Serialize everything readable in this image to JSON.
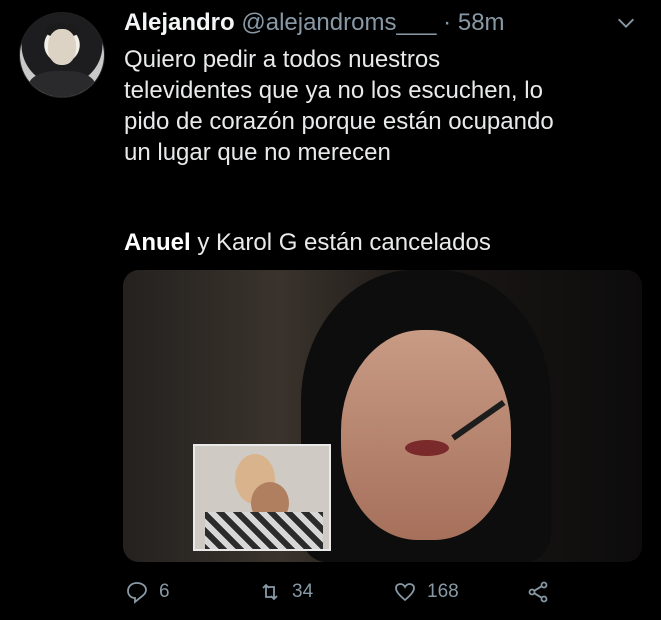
{
  "tweet": {
    "author_name": "Alejandro",
    "handle": "@alejandroms___",
    "separator": "·",
    "time": "58m",
    "text_lines": [
      "Quiero pedir a todos nuestros",
      "televidentes que ya no los escuchen, lo",
      "pido de corazón porque están ocupando",
      "un lugar que no merecen"
    ],
    "line2_bold": "Anuel",
    "line2_rest": " y Karol G están cancelados"
  },
  "actions": {
    "replies": "6",
    "retweets": "34",
    "likes": "168"
  },
  "icons": {
    "reply": "reply-icon",
    "retweet": "retweet-icon",
    "like": "heart-icon",
    "share": "share-icon",
    "menu": "chevron-down-icon"
  },
  "colors": {
    "background": "#000000",
    "text": "#e9eaeb",
    "muted": "#8899a6"
  }
}
